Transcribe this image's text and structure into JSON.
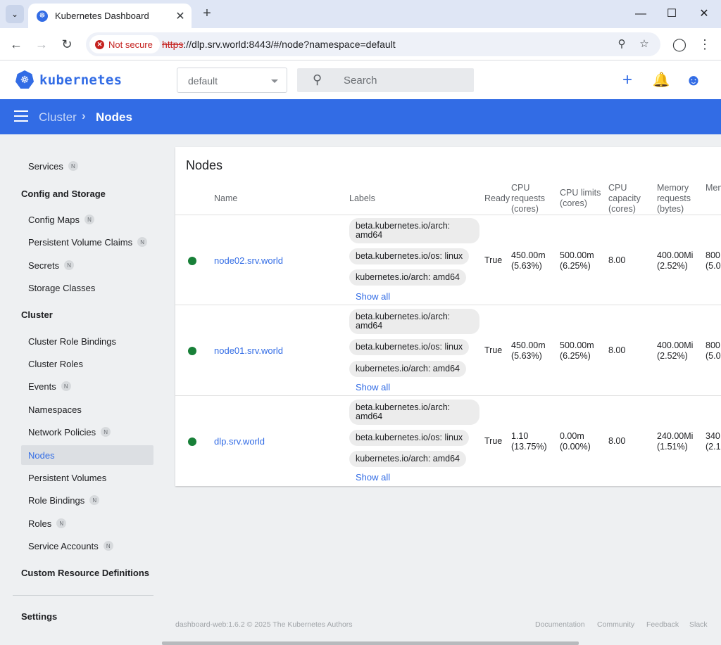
{
  "browser": {
    "tab_title": "Kubernetes Dashboard",
    "tab_menu_icon": "chevron-down-icon",
    "new_tab_label": "+",
    "security_label": "Not secure",
    "url_scheme": "https",
    "url_rest": "://dlp.srv.world:8443/#/node?namespace=default",
    "window_buttons": [
      "minimize-icon",
      "maximize-icon",
      "close-icon"
    ]
  },
  "header": {
    "brand": "kubernetes",
    "namespace": "default",
    "search_placeholder": "Search",
    "accent_color": "#326ce5"
  },
  "breadcrumb": {
    "parent": "Cluster",
    "current": "Nodes"
  },
  "sidebar": {
    "items_top": [
      {
        "label": "Services",
        "badge": "N"
      }
    ],
    "config_storage": {
      "heading": "Config and Storage",
      "items": [
        {
          "label": "Config Maps",
          "badge": "N"
        },
        {
          "label": "Persistent Volume Claims",
          "badge": "N"
        },
        {
          "label": "Secrets",
          "badge": "N"
        },
        {
          "label": "Storage Classes",
          "badge": ""
        }
      ]
    },
    "cluster": {
      "heading": "Cluster",
      "items": [
        {
          "label": "Cluster Role Bindings",
          "badge": ""
        },
        {
          "label": "Cluster Roles",
          "badge": ""
        },
        {
          "label": "Events",
          "badge": "N"
        },
        {
          "label": "Namespaces",
          "badge": ""
        },
        {
          "label": "Network Policies",
          "badge": "N"
        },
        {
          "label": "Nodes",
          "badge": ""
        },
        {
          "label": "Persistent Volumes",
          "badge": ""
        },
        {
          "label": "Role Bindings",
          "badge": "N"
        },
        {
          "label": "Roles",
          "badge": "N"
        },
        {
          "label": "Service Accounts",
          "badge": "N"
        }
      ]
    },
    "crd_heading": "Custom Resource Definitions",
    "settings": "Settings"
  },
  "nodes": {
    "title": "Nodes",
    "columns": {
      "name": "Name",
      "labels": "Labels",
      "ready": "Ready",
      "cpu_requests": "CPU requests (cores)",
      "cpu_limits": "CPU limits (cores)",
      "cpu_capacity": "CPU capacity (cores)",
      "mem_requests": "Memory requests (bytes)",
      "mem_limits": "Memory limits (bytes)"
    },
    "rows": [
      {
        "name": "node02.srv.world",
        "labels": [
          "beta.kubernetes.io/arch: amd64",
          "beta.kubernetes.io/os: linux",
          "kubernetes.io/arch: amd64"
        ],
        "show_all": "Show all",
        "ready": "True",
        "cpu_req": "450.00m",
        "cpu_req_pct": "(5.63%)",
        "cpu_lim": "500.00m",
        "cpu_lim_pct": "(6.25%)",
        "cpu_cap": "8.00",
        "mem_req": "400.00Mi",
        "mem_req_pct": "(2.52%)",
        "mem_lim": "800",
        "mem_lim_pct": "(5.0"
      },
      {
        "name": "node01.srv.world",
        "labels": [
          "beta.kubernetes.io/arch: amd64",
          "beta.kubernetes.io/os: linux",
          "kubernetes.io/arch: amd64"
        ],
        "show_all": "Show all",
        "ready": "True",
        "cpu_req": "450.00m",
        "cpu_req_pct": "(5.63%)",
        "cpu_lim": "500.00m",
        "cpu_lim_pct": "(6.25%)",
        "cpu_cap": "8.00",
        "mem_req": "400.00Mi",
        "mem_req_pct": "(2.52%)",
        "mem_lim": "800",
        "mem_lim_pct": "(5.0"
      },
      {
        "name": "dlp.srv.world",
        "labels": [
          "beta.kubernetes.io/arch: amd64",
          "beta.kubernetes.io/os: linux",
          "kubernetes.io/arch: amd64"
        ],
        "show_all": "Show all",
        "ready": "True",
        "cpu_req": "1.10",
        "cpu_req_pct": "(13.75%)",
        "cpu_lim": "0.00m",
        "cpu_lim_pct": "(0.00%)",
        "cpu_cap": "8.00",
        "mem_req": "240.00Mi",
        "mem_req_pct": "(1.51%)",
        "mem_lim": "340",
        "mem_lim_pct": "(2.1"
      }
    ],
    "status_color": "#188038"
  },
  "footer": {
    "copyright": "dashboard-web:1.6.2 © 2025 The Kubernetes Authors",
    "links": [
      "Documentation",
      "Community",
      "Feedback",
      "Slack"
    ]
  }
}
